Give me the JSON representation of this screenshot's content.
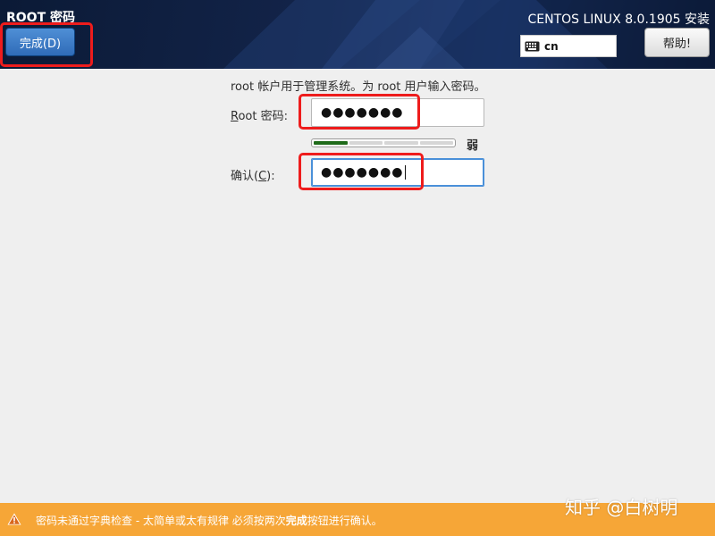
{
  "header": {
    "screen_title": "ROOT 密码",
    "done_button": "完成(D)",
    "product_title": "CENTOS LINUX 8.0.1905 安装",
    "keyboard_layout": "cn",
    "help_button": "帮助!"
  },
  "form": {
    "description": "root 帐户用于管理系统。为 root 用户输入密码。",
    "root_password": {
      "label_mnemonic": "R",
      "label_rest": "oot 密码:",
      "value": "●●●●●●●"
    },
    "strength": {
      "segments_filled": 1,
      "segments_total": 4,
      "label": "弱"
    },
    "confirm": {
      "label_prefix": "确认(",
      "label_mnemonic": "C",
      "label_suffix": "):",
      "value": "●●●●●●●"
    }
  },
  "warning": {
    "text_before": "密码未通过字典检查 - 太简单或太有规律 必须按两次",
    "text_bold": "完成",
    "text_after": "按钮进行确认。"
  },
  "watermark": "知乎 @白树明",
  "colors": {
    "header_bg": "#13244a",
    "done_button": "#3b7bc8",
    "annotation": "#ee1c1c",
    "warning_bar": "#f6a637",
    "strength_fill": "#1f6b1a"
  },
  "icons": [
    "keyboard-icon",
    "warning-icon"
  ]
}
